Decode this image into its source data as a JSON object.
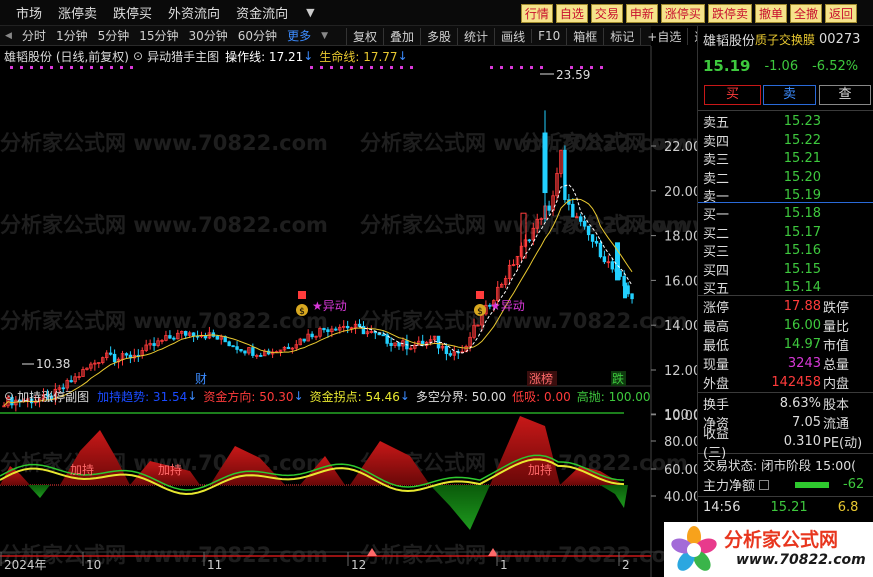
{
  "topmenu": {
    "items": [
      "市场",
      "涨停卖",
      "跌停买",
      "外资流向",
      "资金流向"
    ]
  },
  "actions": [
    "行情",
    "自选",
    "交易",
    "申新",
    "涨停买",
    "跌停卖",
    "撤单",
    "全撤",
    "返回"
  ],
  "timeframes": [
    "分时",
    "1分钟",
    "5分钟",
    "15分钟",
    "30分钟",
    "60分钟"
  ],
  "timeframes_more": "更多",
  "right_tools": [
    "复权",
    "叠加",
    "多股",
    "统计",
    "画线",
    "F10",
    "箱框",
    "标记",
    "+自选",
    "返回"
  ],
  "main_indicator": {
    "stock": "雄韬股份 (日线,前复权)",
    "name": "异动猎手主图",
    "op_line": "操作线: 17.21",
    "life_line": "生命线: 17.77"
  },
  "price_axis": [
    "22.00",
    "20.00",
    "18.00",
    "16.00",
    "14.00",
    "12.00",
    "10.00"
  ],
  "markers": {
    "high": "23.59",
    "low": "10.38",
    "anomaly1": "异动",
    "anomaly2": "异动",
    "cai": "财",
    "zhangbang": "涨榜",
    "die": "跌"
  },
  "sub_indicator": {
    "name": "加持涨停副图",
    "cl": "加持趋势: 31.54",
    "fx": "资金方向: 50.30",
    "gd": "资金拐点: 54.46",
    "dk": "多空分界: 50.00",
    "lo": "低吸: 0.00",
    "hi": "高抛: 100.00",
    "zone_label": "加持"
  },
  "sub_axis": [
    "100.0",
    "80.00",
    "60.00",
    "40.00"
  ],
  "x_axis": [
    "2024年",
    "10",
    "11",
    "12",
    "1",
    "2"
  ],
  "quote": {
    "name": "雄韬股份",
    "badge": "质子交换膜",
    "code": "00273",
    "price": "15.19",
    "change": "-1.06",
    "pct": "-6.52%",
    "buy_btn": "买",
    "sell_btn": "卖",
    "query_btn": "查",
    "asks": [
      {
        "l": "卖五",
        "p": "15.23"
      },
      {
        "l": "卖四",
        "p": "15.22"
      },
      {
        "l": "卖三",
        "p": "15.21"
      },
      {
        "l": "卖二",
        "p": "15.20"
      },
      {
        "l": "卖一",
        "p": "15.19"
      }
    ],
    "bids": [
      {
        "l": "买一",
        "p": "15.18"
      },
      {
        "l": "买二",
        "p": "15.17"
      },
      {
        "l": "买三",
        "p": "15.16"
      },
      {
        "l": "买四",
        "p": "15.15"
      },
      {
        "l": "买五",
        "p": "15.14"
      }
    ],
    "stats": [
      {
        "l": "涨停",
        "v": "17.88",
        "c": "#ff3b3b",
        "r": "跌停"
      },
      {
        "l": "最高",
        "v": "16.00",
        "c": "#3ec93e",
        "r": "量比"
      },
      {
        "l": "最低",
        "v": "14.97",
        "c": "#3ec93e",
        "r": "市值"
      },
      {
        "l": "现量",
        "v": "3243",
        "c": "#d838d8",
        "r": "总量"
      },
      {
        "l": "外盘",
        "v": "142458",
        "c": "#ff3b3b",
        "r": "内盘"
      }
    ],
    "stats2": [
      {
        "l": "换手",
        "v": "8.63%",
        "r": "股本"
      },
      {
        "l": "净资",
        "v": "7.05",
        "r": "流通"
      },
      {
        "l": "收益(三)",
        "v": "0.310",
        "r": "PE(动)"
      }
    ],
    "trade_state": "交易状态: 闭市阶段 15:00(",
    "net_main": "主力净额",
    "net_val": "-62",
    "tick_time": "14:56",
    "tick_price": "15.21",
    "tick_vol": "6.8"
  },
  "watermark": "分析家公式网 www.70822.com",
  "logo": {
    "title": "分析家公式网",
    "url": "www.70822.com"
  }
}
